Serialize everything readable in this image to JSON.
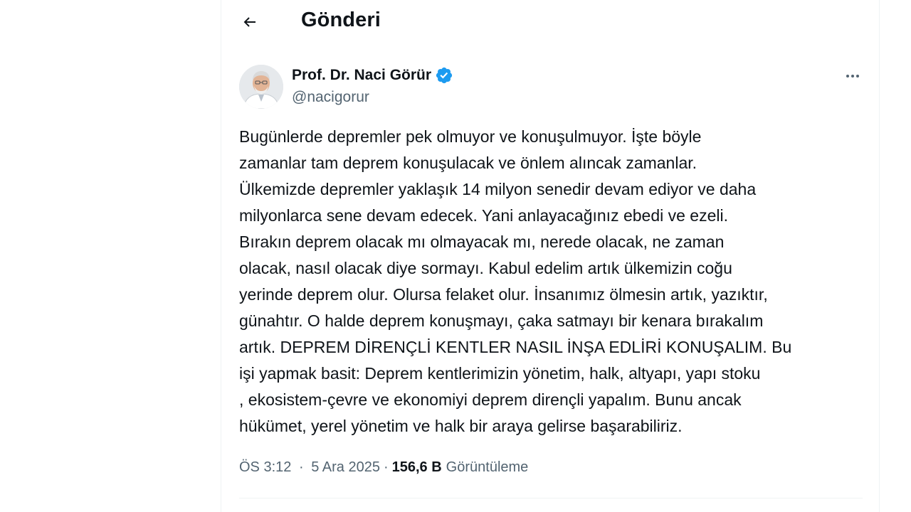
{
  "header": {
    "title": "Gönderi",
    "back_icon": "arrow-left-icon"
  },
  "tweet": {
    "author_name": "Prof. Dr. Naci Görür",
    "handle": "@nacigorur",
    "verified": true,
    "verified_color": "#1d9bf0",
    "text": "Bugünlerde depremler pek olmuyor ve konuşulmuyor. İşte böyle\nzamanlar tam deprem konuşulacak ve önlem alıncak zamanlar.\nÜlkemizde depremler yaklaşık 14 milyon senedir devam ediyor ve daha\nmilyonlarca sene devam edecek. Yani anlayacağınız ebedi ve ezeli.\nBırakın deprem olacak mı olmayacak mı, nerede olacak, ne zaman\nolacak, nasıl olacak diye sormayı. Kabul edelim artık ülkemizin coğu\nyerinde deprem olur. Olursa felaket olur. İnsanımız ölmesin artık, yazıktır,\ngünahtır. O halde deprem konuşmayı, çaka satmayı bir kenara bırakalım\nartık. DEPREM DİRENÇLİ KENTLER NASIL İNŞA EDLİRİ KONUŞALIM. Bu\nişi yapmak basit: Deprem kentlerimizin yönetim, halk, altyapı, yapı stoku\n, ekosistem-çevre ve ekonomiyi deprem dirençli yapalım. Bunu ancak\nhükümet, yerel yönetim ve halk bir araya gelirse başarabiliriz.",
    "time": "ÖS 3:12",
    "separator": "·",
    "date": "5 Ara 2025",
    "views_count": "156,6 B",
    "views_label": "Görüntüleme",
    "more_icon": "more-horizontal-icon"
  }
}
